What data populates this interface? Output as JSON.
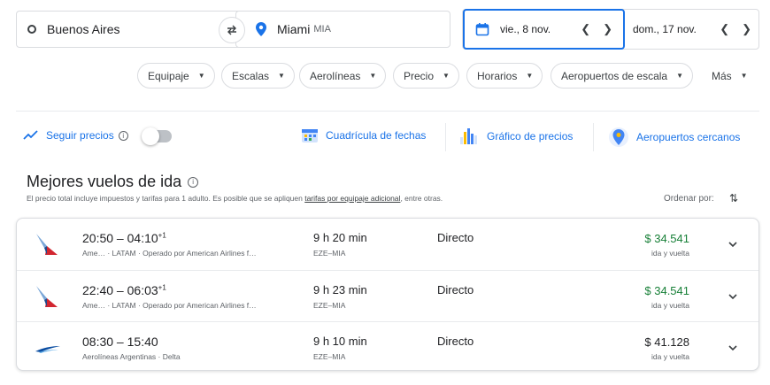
{
  "search": {
    "origin": "Buenos Aires",
    "destination_city": "Miami",
    "destination_code": "MIA",
    "departure_date": "vie., 8 nov.",
    "return_date": "dom., 17 nov."
  },
  "filters": [
    "Equipaje",
    "Escalas",
    "Aerolíneas",
    "Precio",
    "Horarios",
    "Aeropuertos de escala"
  ],
  "more_filters": "Más",
  "tools": {
    "track_prices": "Seguir precios",
    "date_grid": "Cuadrícula de fechas",
    "price_graph": "Gráfico de precios",
    "nearby_airports": "Aeropuertos cercanos",
    "track_enabled": false
  },
  "results": {
    "title": "Mejores vuelos de ida",
    "disclaimer_before": "El precio total incluye impuestos y tarifas para 1 adulto. Es posible que se apliquen ",
    "disclaimer_link": "tarifas por equipaje adicional",
    "disclaimer_after": ", entre otras.",
    "sort_label": "Ordenar por:"
  },
  "flights": [
    {
      "depart": "20:50",
      "arrive": "04:10",
      "day_offset": "+1",
      "airlines": "Ame… · LATAM · Operado por American Airlines f…",
      "duration": "9 h 20 min",
      "route": "EZE–MIA",
      "stops": "Directo",
      "price": "$ 34.541",
      "trip": "ida y vuelta",
      "logo": "american-airlines-logo"
    },
    {
      "depart": "22:40",
      "arrive": "06:03",
      "day_offset": "+1",
      "airlines": "Ame… · LATAM · Operado por American Airlines f…",
      "duration": "9 h 23 min",
      "route": "EZE–MIA",
      "stops": "Directo",
      "price": "$ 34.541",
      "trip": "ida y vuelta",
      "logo": "american-airlines-logo"
    },
    {
      "depart": "08:30",
      "arrive": "15:40",
      "day_offset": "",
      "airlines": "Aerolíneas Argentinas · Delta",
      "duration": "9 h 10 min",
      "route": "EZE–MIA",
      "stops": "Directo",
      "price": "$ 41.128",
      "trip": "ida y vuelta",
      "logo": "aerolineas-argentinas-logo"
    }
  ],
  "colors": {
    "accent": "#1a73e8",
    "price_low": "#188038",
    "text": "#202124",
    "muted": "#5f6368",
    "border": "#dadce0"
  }
}
